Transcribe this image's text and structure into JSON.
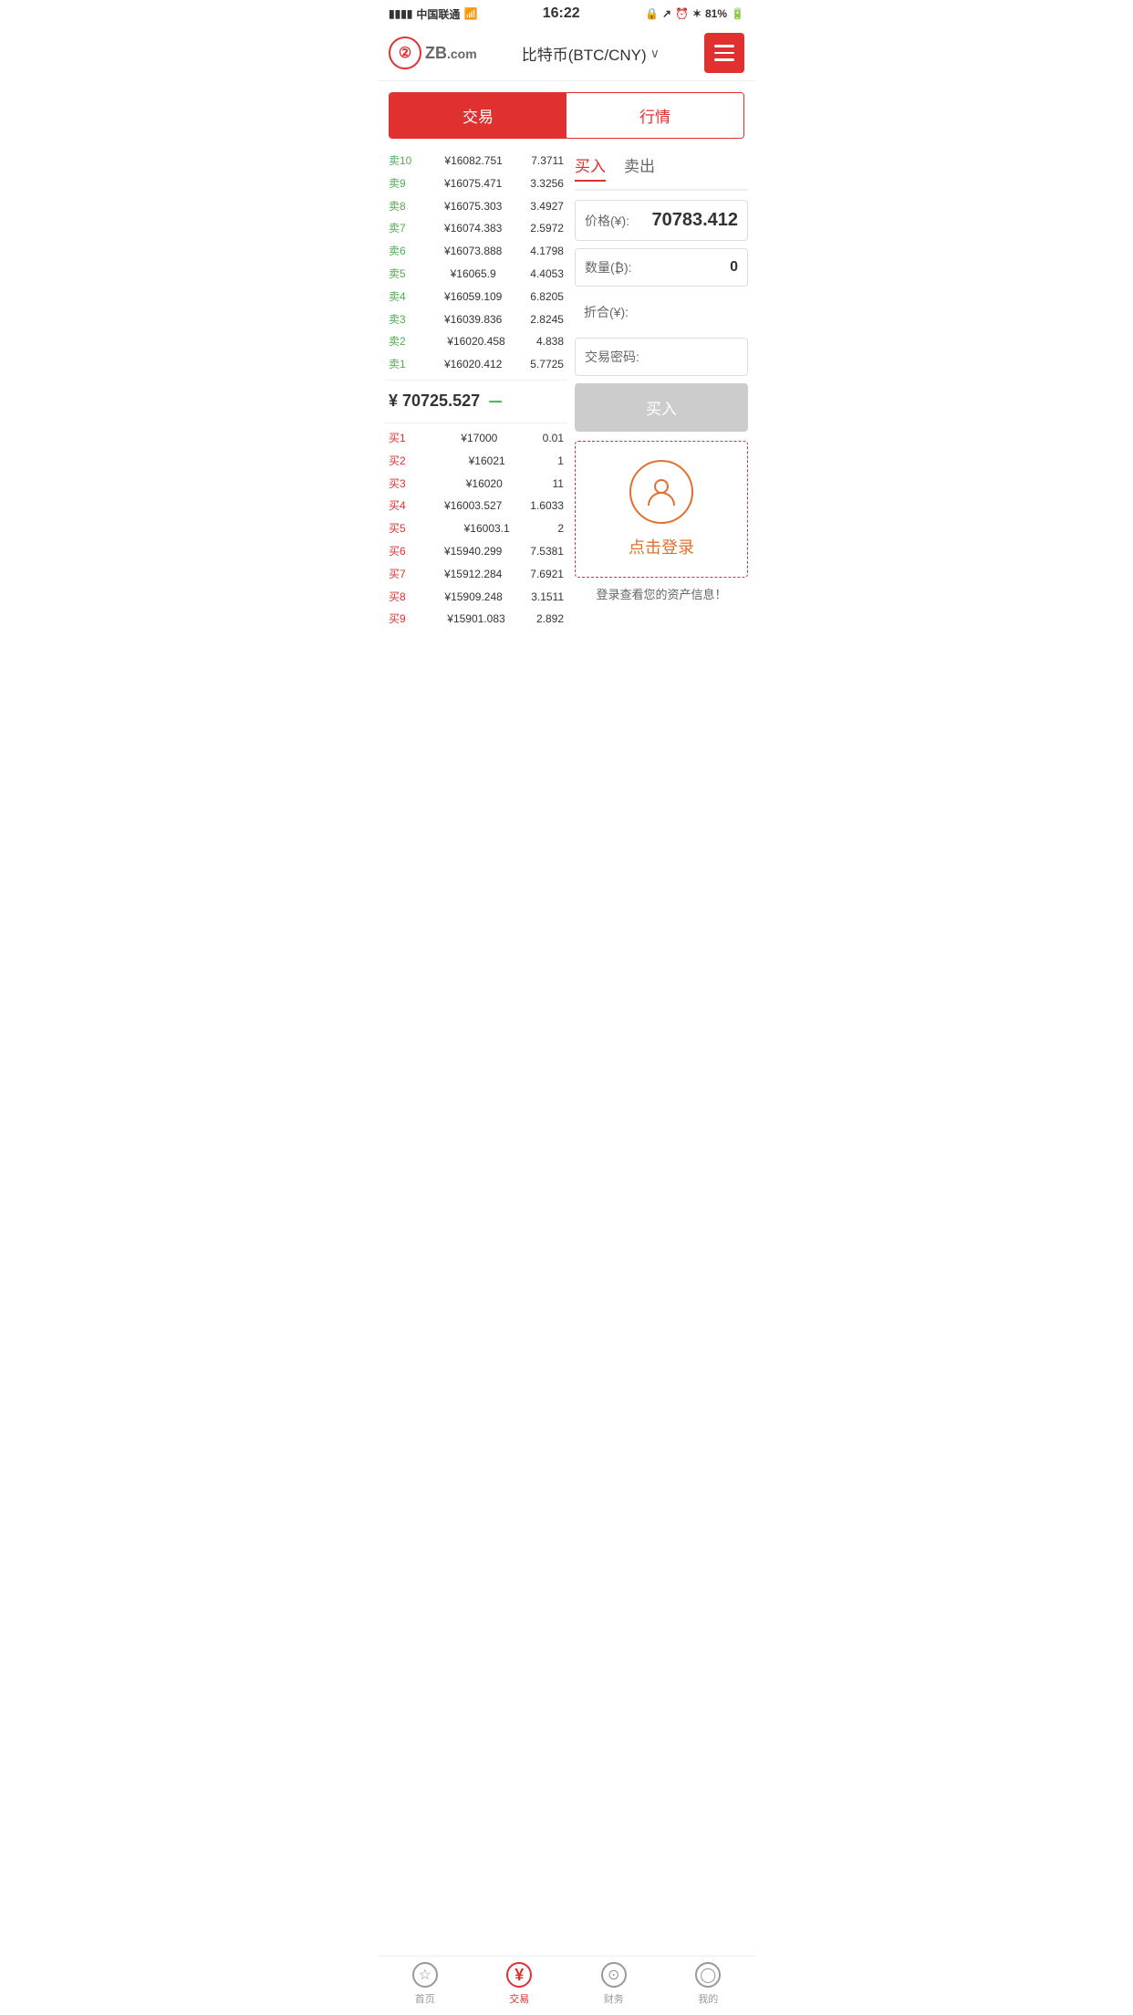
{
  "statusBar": {
    "carrier": "中国联通",
    "time": "16:22",
    "battery": "81%"
  },
  "header": {
    "logoText": "ZB",
    "logoDomain": ".com",
    "title": "比特币(BTC/CNY)",
    "menuLabel": "menu"
  },
  "tabs": {
    "trade": "交易",
    "market": "行情"
  },
  "orderBook": {
    "sellOrders": [
      {
        "label": "卖10",
        "price": "¥16082.751",
        "amount": "7.3711"
      },
      {
        "label": "卖9",
        "price": "¥16075.471",
        "amount": "3.3256"
      },
      {
        "label": "卖8",
        "price": "¥16075.303",
        "amount": "3.4927"
      },
      {
        "label": "卖7",
        "price": "¥16074.383",
        "amount": "2.5972"
      },
      {
        "label": "卖6",
        "price": "¥16073.888",
        "amount": "4.1798"
      },
      {
        "label": "卖5",
        "price": "¥16065.9",
        "amount": "4.4053"
      },
      {
        "label": "卖4",
        "price": "¥16059.109",
        "amount": "6.8205"
      },
      {
        "label": "卖3",
        "price": "¥16039.836",
        "amount": "2.8245"
      },
      {
        "label": "卖2",
        "price": "¥16020.458",
        "amount": "4.838"
      },
      {
        "label": "卖1",
        "price": "¥16020.412",
        "amount": "5.7725"
      }
    ],
    "currentPrice": "¥ 70725.527",
    "currentTrend": "－",
    "buyOrders": [
      {
        "label": "买1",
        "price": "¥17000",
        "amount": "0.01"
      },
      {
        "label": "买2",
        "price": "¥16021",
        "amount": "1"
      },
      {
        "label": "买3",
        "price": "¥16020",
        "amount": "11"
      },
      {
        "label": "买4",
        "price": "¥16003.527",
        "amount": "1.6033"
      },
      {
        "label": "买5",
        "price": "¥16003.1",
        "amount": "2"
      },
      {
        "label": "买6",
        "price": "¥15940.299",
        "amount": "7.5381"
      },
      {
        "label": "买7",
        "price": "¥15912.284",
        "amount": "7.6921"
      },
      {
        "label": "买8",
        "price": "¥15909.248",
        "amount": "3.1511"
      },
      {
        "label": "买9",
        "price": "¥15901.083",
        "amount": "2.892"
      }
    ]
  },
  "tradePanel": {
    "buyTab": "买入",
    "sellTab": "卖出",
    "priceLabel": "价格(¥):",
    "priceValue": "70783.412",
    "quantityLabel": "数量(₿):",
    "quantityValue": "0",
    "totalLabel": "折合(¥):",
    "totalValue": "",
    "passwordLabel": "交易密码:",
    "passwordValue": "",
    "buyButton": "买入"
  },
  "loginBox": {
    "loginText": "点击登录",
    "assetInfo": "登录查看您的资产信息！"
  },
  "bottomNav": [
    {
      "label": "首页",
      "icon": "⭐",
      "active": false
    },
    {
      "label": "交易",
      "icon": "¥",
      "active": true
    },
    {
      "label": "财务",
      "icon": "💰",
      "active": false
    },
    {
      "label": "我的",
      "icon": "👤",
      "active": false
    }
  ]
}
